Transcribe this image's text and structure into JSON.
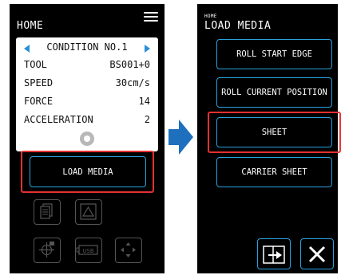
{
  "left": {
    "title": "HOME",
    "condition": "CONDITION NO.1",
    "rows": [
      {
        "label": "TOOL",
        "value": "BS001+0"
      },
      {
        "label": "SPEED",
        "value": "30cm/s"
      },
      {
        "label": "FORCE",
        "value": "14"
      },
      {
        "label": "ACCELERATION",
        "value": "2"
      }
    ],
    "load_media_label": "LOAD MEDIA",
    "usb_label": "USB"
  },
  "right": {
    "breadcrumb": "HOME",
    "title": "LOAD MEDIA",
    "options": [
      {
        "label": "ROLL START EDGE"
      },
      {
        "label": "ROLL CURRENT POSITION"
      },
      {
        "label": "SHEET"
      },
      {
        "label": "CARRIER SHEET"
      }
    ]
  },
  "colors": {
    "accent": "#29a3e0",
    "highlight": "#e53030",
    "arrow": "#1f6fbf"
  }
}
